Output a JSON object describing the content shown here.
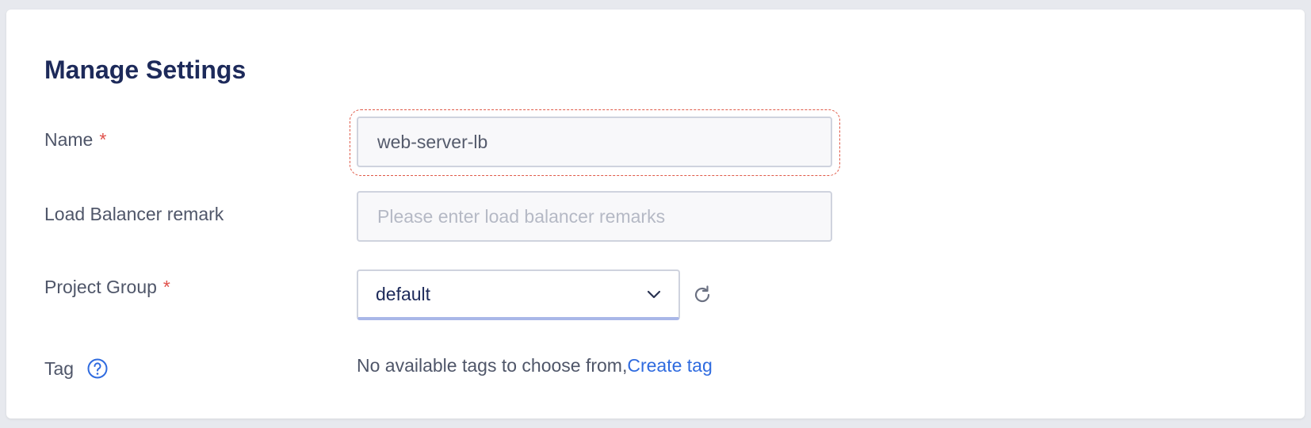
{
  "form": {
    "title": "Manage Settings",
    "required_mark": "*",
    "name": {
      "label": "Name",
      "value": "web-server-lb"
    },
    "remark": {
      "label": "Load Balancer remark",
      "placeholder": "Please enter load balancer remarks",
      "value": ""
    },
    "project_group": {
      "label": "Project Group",
      "selected": "default",
      "refresh_icon": "refresh-icon",
      "dropdown_icon": "chevron-down-icon"
    },
    "tag": {
      "label": "Tag",
      "help_icon": "help-circle-icon",
      "empty_text": "No available tags to choose from,",
      "create_link": "Create tag"
    }
  },
  "colors": {
    "title": "#1d2a5a",
    "required": "#e0504a",
    "link": "#2f6bdf",
    "focus_ring": "#e05a48"
  }
}
